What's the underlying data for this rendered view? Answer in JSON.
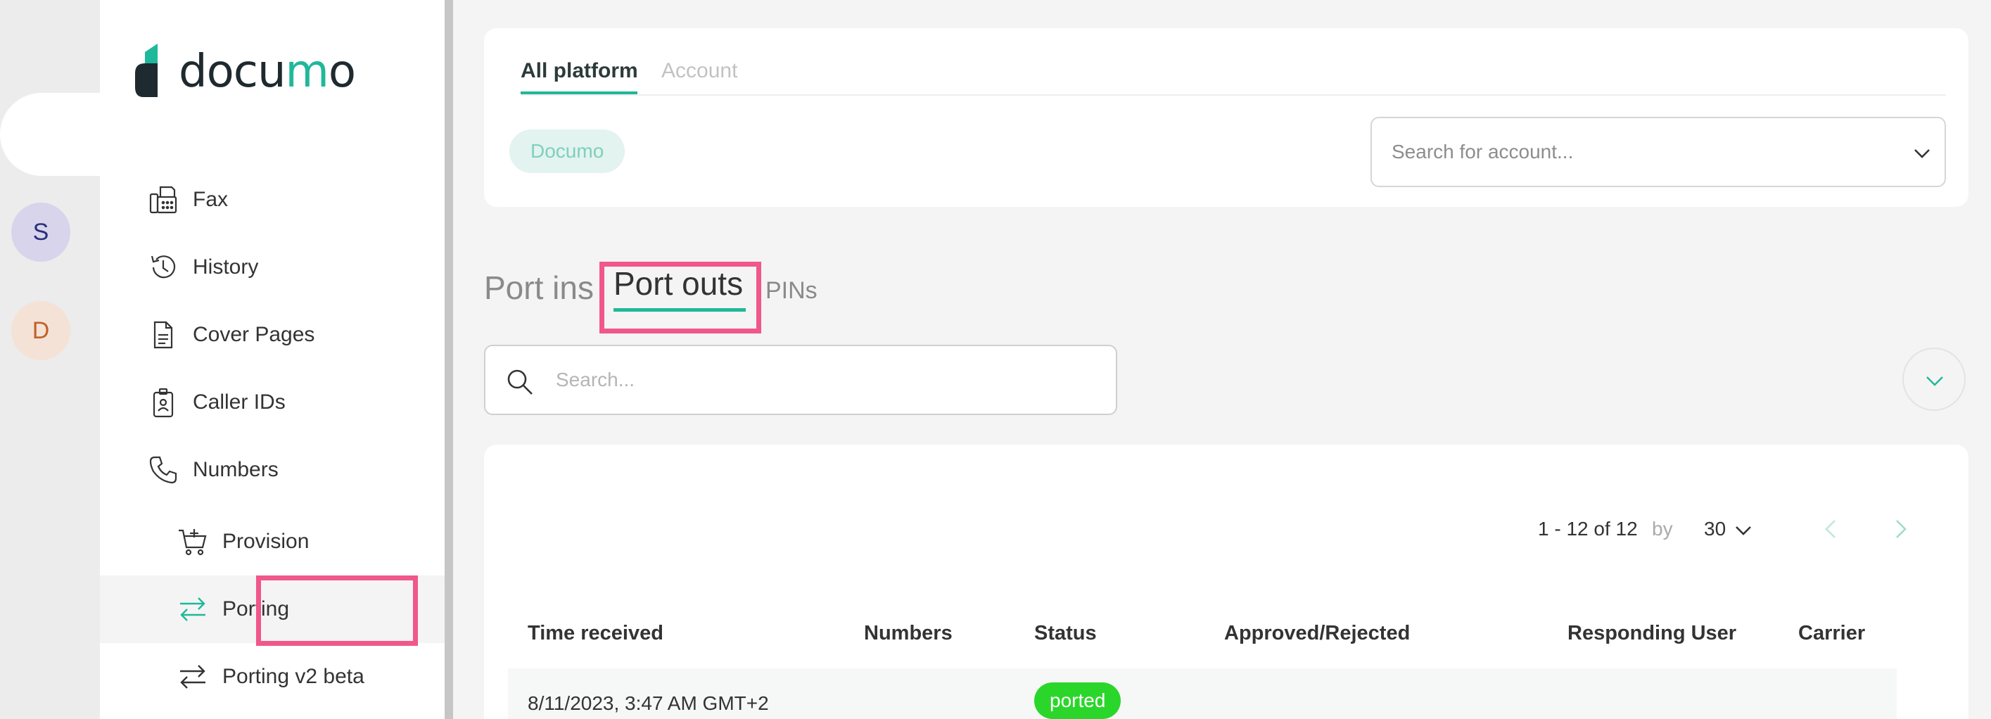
{
  "rail": {
    "avatars": [
      {
        "letter": "S"
      },
      {
        "letter": "D"
      }
    ]
  },
  "brand": {
    "logo_text_start": "docu",
    "logo_text_accent": "m",
    "logo_text_end": "o",
    "accent_color": "#1fb89a"
  },
  "sidebar": {
    "items": [
      {
        "label": "Fax",
        "icon": "fax-icon"
      },
      {
        "label": "History",
        "icon": "history-icon"
      },
      {
        "label": "Cover Pages",
        "icon": "document-icon"
      },
      {
        "label": "Caller IDs",
        "icon": "badge-icon"
      },
      {
        "label": "Numbers",
        "icon": "phone-icon"
      },
      {
        "label": "Provision",
        "icon": "cart-icon"
      },
      {
        "label": "Porting",
        "icon": "swap-arrows-icon",
        "active": true
      },
      {
        "label": "Porting v2 beta",
        "icon": "swap-arrows-icon"
      }
    ]
  },
  "scope": {
    "tabs": [
      {
        "label": "All platform",
        "active": true
      },
      {
        "label": "Account",
        "active": false
      }
    ],
    "chip": "Documo",
    "account_search_placeholder": "Search for account..."
  },
  "port_tabs": {
    "items": [
      {
        "label": "Port ins"
      },
      {
        "label": "Port outs",
        "active": true
      },
      {
        "label": "PINs"
      }
    ]
  },
  "search": {
    "placeholder": "Search..."
  },
  "pager": {
    "range": "1 - 12 of 12",
    "by": "by",
    "page_size": "30"
  },
  "table": {
    "columns": [
      "Time received",
      "Numbers",
      "Status",
      "Approved/Rejected",
      "Responding User",
      "Carrier"
    ],
    "rows": [
      {
        "time": "8/11/2023, 3:47 AM GMT+2",
        "numbers": "",
        "status": "ported",
        "approved": "",
        "user": "",
        "carrier": ""
      }
    ],
    "status_color": "#2bd62b"
  },
  "highlight_color": "#f0578a"
}
